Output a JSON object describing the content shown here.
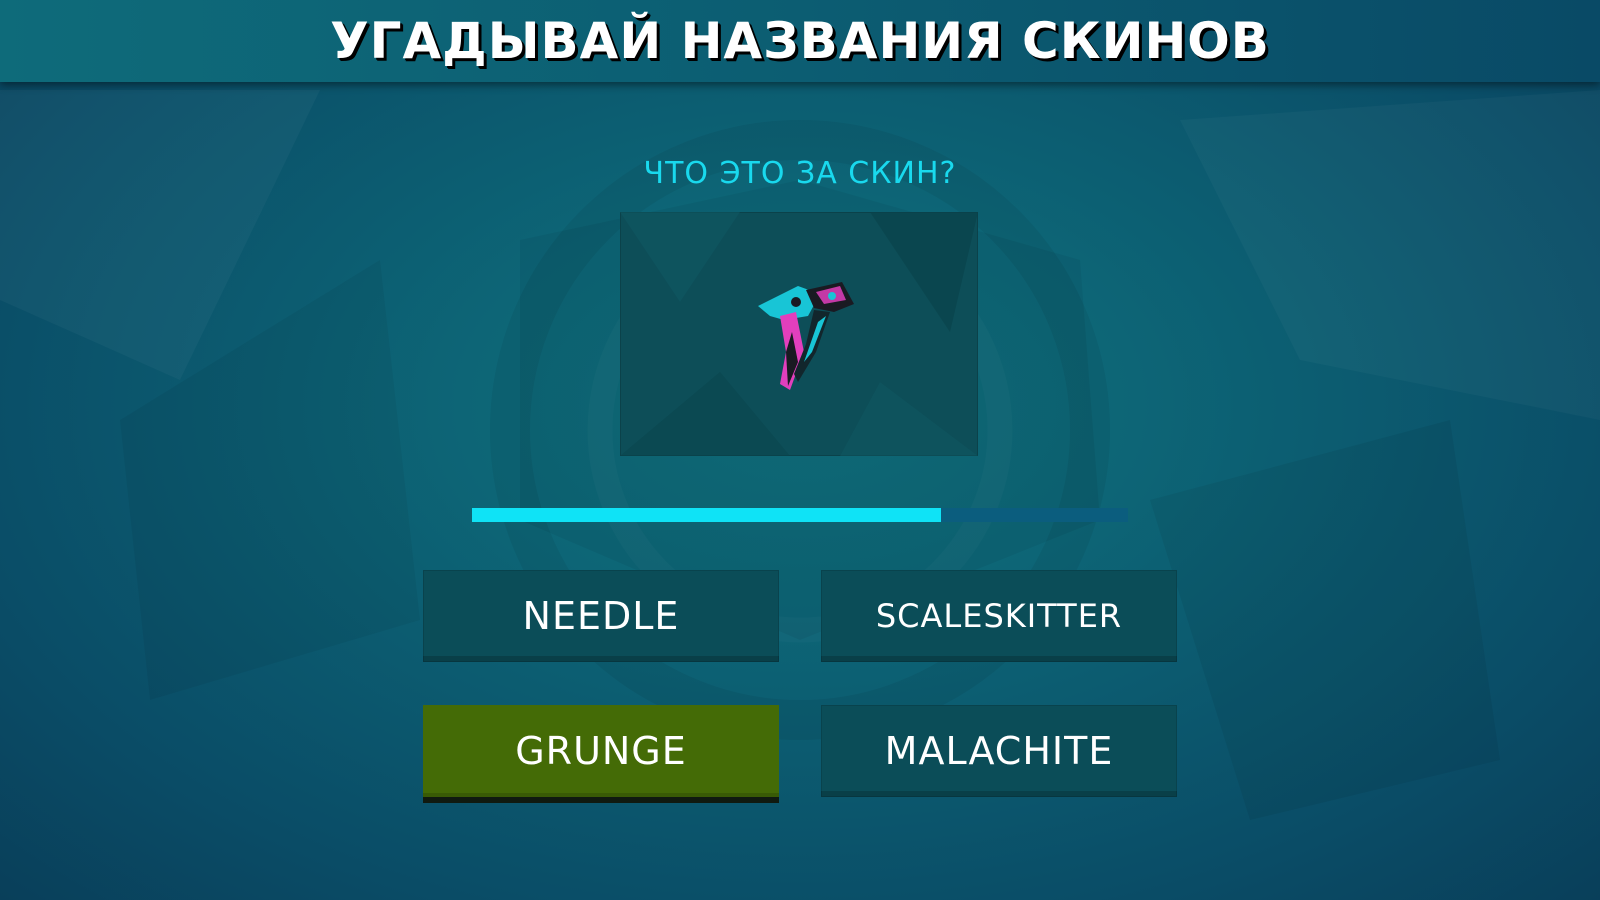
{
  "header": {
    "title": "УГАДЫВАЙ НАЗВАНИЯ СКИНОВ"
  },
  "quiz": {
    "question": "ЧТО ЭТО ЗА СКИН?",
    "skin_image": "crossed-knives-icon",
    "timer_progress": 0.715,
    "answers": [
      {
        "label": "NEEDLE",
        "state": "default"
      },
      {
        "label": "SCALESKITTER",
        "state": "default"
      },
      {
        "label": "GRUNGE",
        "state": "correct"
      },
      {
        "label": "MALACHITE",
        "state": "default"
      }
    ]
  },
  "colors": {
    "accent_cyan": "#0fe3f6",
    "correct_green": "#446b06",
    "button_bg": "#0b4d58",
    "title_text": "#ffffff"
  }
}
